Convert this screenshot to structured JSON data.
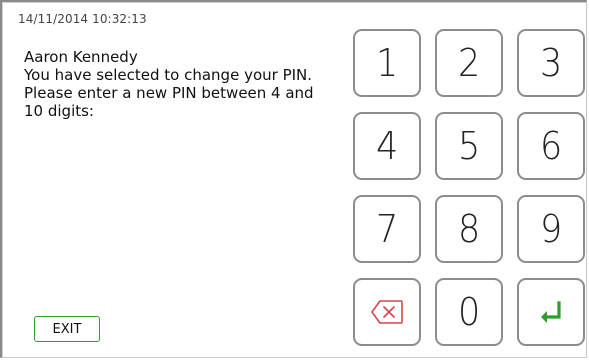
{
  "header": {
    "timestamp": "14/11/2014 10:32:13"
  },
  "message": {
    "lines": [
      "Aaron Kennedy",
      "You have selected to change your PIN.",
      "Please enter a new PIN between 4 and",
      "10 digits:"
    ]
  },
  "footer": {
    "exit_label": "EXIT"
  },
  "keypad": {
    "keys": [
      "1",
      "2",
      "3",
      "4",
      "5",
      "6",
      "7",
      "8",
      "9",
      "0"
    ],
    "backspace_icon": "backspace-icon",
    "enter_icon": "enter-icon"
  },
  "colors": {
    "accent_green": "#2e9e2e",
    "backspace_red": "#d9434d",
    "key_border": "#8c8c8c"
  }
}
